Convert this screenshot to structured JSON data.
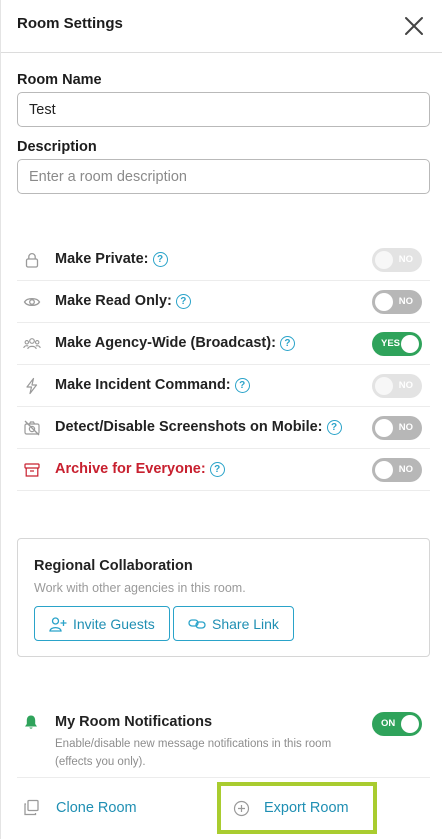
{
  "header": {
    "title": "Room Settings",
    "close_icon": "close-icon"
  },
  "room_name": {
    "label": "Room Name",
    "value": "Test"
  },
  "description": {
    "label": "Description",
    "placeholder": "Enter a room description",
    "value": ""
  },
  "settings": [
    {
      "label": "Make Private:",
      "icon": "lock-icon",
      "state": "NO",
      "disabled": true,
      "danger": false
    },
    {
      "label": "Make Read Only:",
      "icon": "eye-icon",
      "state": "NO",
      "disabled": false,
      "danger": false
    },
    {
      "label": "Make Agency-Wide (Broadcast):",
      "icon": "people-icon",
      "state": "YES",
      "disabled": false,
      "danger": false
    },
    {
      "label": "Make Incident Command:",
      "icon": "lightning-icon",
      "state": "NO",
      "disabled": true,
      "danger": false
    },
    {
      "label": "Detect/Disable Screenshots on Mobile:",
      "icon": "no-camera-icon",
      "state": "NO",
      "disabled": false,
      "danger": false
    },
    {
      "label": "Archive for Everyone:",
      "icon": "archive-icon",
      "state": "NO",
      "disabled": false,
      "danger": true
    }
  ],
  "collaboration": {
    "title": "Regional Collaboration",
    "subtitle": "Work with other agencies in this room.",
    "invite_label": "Invite Guests",
    "share_label": "Share Link"
  },
  "notifications": {
    "title": "My Room Notifications",
    "description": "Enable/disable new message notifications in this room (effects you only).",
    "state": "ON"
  },
  "actions": {
    "clone_label": "Clone Room",
    "export_label": "Export Room"
  },
  "colors": {
    "accent": "#1f8fb3",
    "on": "#2fa35b",
    "danger": "#c8202f",
    "highlight": "#a9cc2f"
  }
}
